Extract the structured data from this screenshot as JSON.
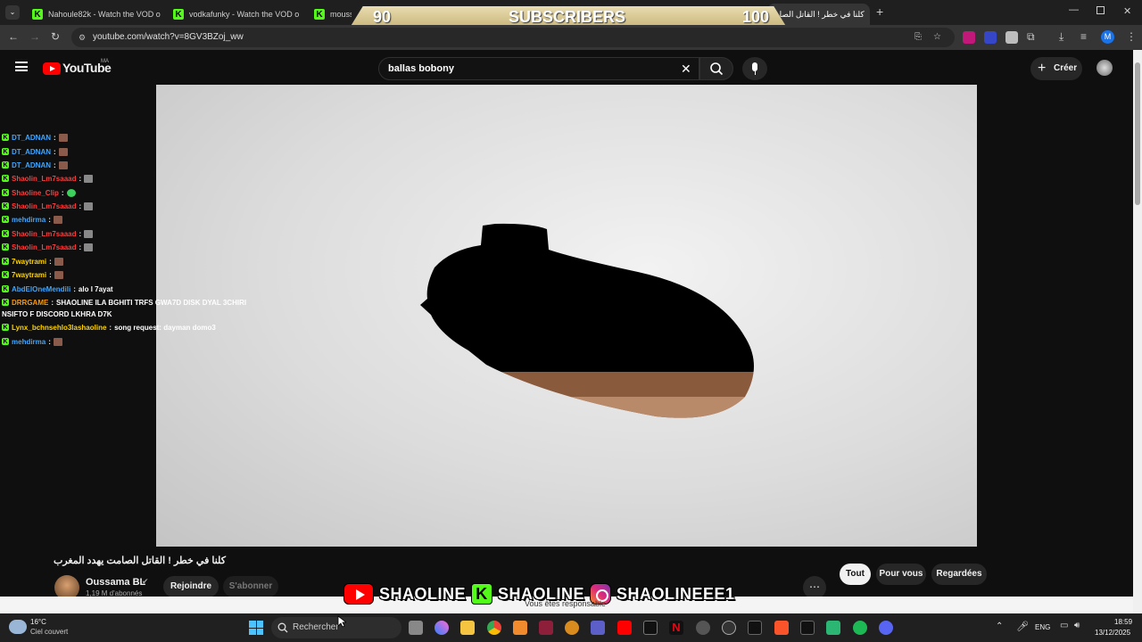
{
  "browser": {
    "tabs": [
      {
        "label": "Nahoule82k - Watch the VOD o",
        "active": false
      },
      {
        "label": "vodkafunky - Watch the VOD o",
        "active": false
      },
      {
        "label": "moussa",
        "active": false
      },
      {
        "label": "كلنا في خطر ! القاتل الصام",
        "active": true
      }
    ],
    "new_tab": "+",
    "url": "youtube.com/watch?v=8GV3BZoj_ww",
    "profile_initial": "M"
  },
  "sub_banner": {
    "left_count": "90",
    "label": "SUBSCRIBERS",
    "right_count": "100"
  },
  "youtube": {
    "logo_text": "YouTube",
    "country_code": "MA",
    "search_query": "ballas bobony",
    "create_label": "Créer",
    "video_title": "كلنا في خطر ! القاتل الصامت يهدد المغرب",
    "channel_name": "Oussama BL",
    "subscribers": "1,19 M d'abonnés",
    "join_label": "Rejoindre",
    "subscribe_label": "S'abonner",
    "filters": [
      "Tout",
      "Pour vous",
      "Regardées"
    ]
  },
  "chat": [
    {
      "user": "DT_ADNAN",
      "color": "#3ea6ff",
      "msg": "",
      "emote": "brown"
    },
    {
      "user": "DT_ADNAN",
      "color": "#3ea6ff",
      "msg": "",
      "emote": "brown"
    },
    {
      "user": "DT_ADNAN",
      "color": "#3ea6ff",
      "msg": "",
      "emote": "brown"
    },
    {
      "user": "Shaolin_Lm7saaad",
      "color": "#ff3b3b",
      "msg": "",
      "emote": "gray"
    },
    {
      "user": "Shaoline_Clip",
      "color": "#ff3b3b",
      "msg": "",
      "emote": "green"
    },
    {
      "user": "Shaolin_Lm7saaad",
      "color": "#ff3b3b",
      "msg": "",
      "emote": "gray"
    },
    {
      "user": "mehdirma",
      "color": "#3ea6ff",
      "msg": "",
      "emote": "brown"
    },
    {
      "user": "Shaolin_Lm7saaad",
      "color": "#ff3b3b",
      "msg": "",
      "emote": "gray"
    },
    {
      "user": "Shaolin_Lm7saaad",
      "color": "#ff3b3b",
      "msg": "",
      "emote": "gray"
    },
    {
      "user": "7waytrami",
      "color": "#ffd400",
      "msg": "",
      "emote": "brown"
    },
    {
      "user": "7waytrami",
      "color": "#ffd400",
      "msg": "",
      "emote": "brown"
    },
    {
      "user": "AbdElOneMendili",
      "color": "#3ea6ff",
      "msg": "alo l 7ayat",
      "emote": ""
    },
    {
      "user": "DRRGAME",
      "color": "#ff9900",
      "msg": "SHAOLINE ILA BGHITI TRFS GWA7D DISK DYAL 3CHIRI",
      "emote": ""
    },
    {
      "user": "",
      "color": "#ffffff",
      "msg": "NSIFTO F DISCORD LKHRA D7K",
      "emote": ""
    },
    {
      "user": "Lynx_bchnsehlo3lashaoline",
      "color": "#ffd400",
      "msg": "song request: dayman domo3",
      "emote": ""
    },
    {
      "user": "mehdirma",
      "color": "#3ea6ff",
      "msg": "",
      "emote": "brown"
    }
  ],
  "social_banner": [
    "SHAOLINE",
    "SHAOLINE",
    "SHAOLINEEE1"
  ],
  "overlay_text": "Vous êtes responsable",
  "taskbar": {
    "weather_temp": "16°C",
    "weather_desc": "Ciel couvert",
    "search_placeholder": "Rechercher",
    "lang": "ENG",
    "time": "18:59",
    "date": "13/12/2025"
  },
  "colors": {
    "youtube_red": "#ff0000",
    "kick_green": "#53fc18",
    "banner_gold": "#c9b67a"
  }
}
